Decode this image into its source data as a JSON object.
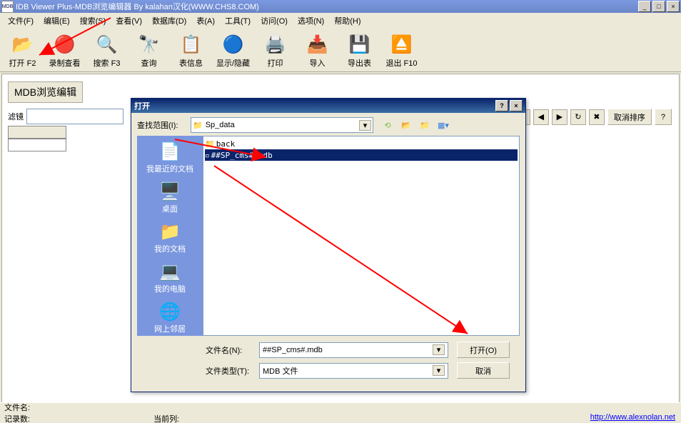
{
  "titlebar": {
    "app_icon": "MDB",
    "title": "IDB Viewer Plus-MDB浏览编辑器 By kalahan汉化(WWW.CHS8.COM)"
  },
  "menubar": {
    "items": [
      "文件(F)",
      "编辑(E)",
      "搜索(S)",
      "查看(V)",
      "数据库(D)",
      "表(A)",
      "工具(T)",
      "访问(O)",
      "选项(N)",
      "帮助(H)"
    ]
  },
  "toolbar": {
    "open": "打开 F2",
    "record": "录制查看",
    "search": "搜索 F3",
    "query": "查询",
    "tableinfo": "表信息",
    "showhide": "显示/隐藏",
    "print": "打印",
    "import": "导入",
    "export": "导出表",
    "exit": "退出 F10"
  },
  "main": {
    "tab": "MDB浏览编辑",
    "filter_label": "滤镜",
    "cancel_sort": "取消排序",
    "help": "?"
  },
  "dialog": {
    "title": "打开",
    "lookin_label": "查找范围(I):",
    "lookin_value": "Sp_data",
    "sidebar": {
      "recent": "我最近的文档",
      "desktop": "桌面",
      "mydocs": "我的文档",
      "mycomputer": "我的电脑",
      "network": "网上邻居"
    },
    "files": {
      "folder": "back",
      "selected": "##SP_cms#.mdb"
    },
    "filename_label": "文件名(N):",
    "filename_value": "##SP_cms#.mdb",
    "filetype_label": "文件类型(T):",
    "filetype_value": "MDB 文件",
    "open_btn": "打开(O)",
    "cancel_btn": "取消"
  },
  "statusbar": {
    "filename": "文件名:",
    "records": "记录数:",
    "current": "当前列:",
    "link": "http://www.alexnolan.net"
  }
}
